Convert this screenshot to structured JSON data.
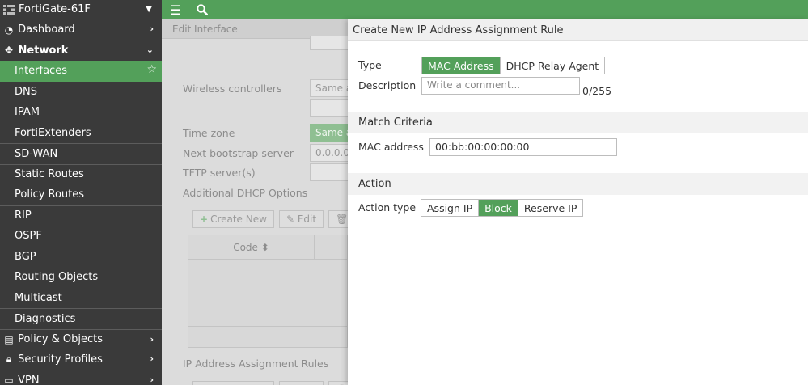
{
  "device": {
    "name": "FortiGate-61F"
  },
  "sidebar": {
    "top": [
      {
        "label": "Dashboard",
        "icon": "dashboard-icon"
      },
      {
        "label": "Network",
        "icon": "network-icon"
      }
    ],
    "network_items": [
      "Interfaces",
      "DNS",
      "IPAM",
      "FortiExtenders",
      "SD-WAN",
      "Static Routes",
      "Policy Routes",
      "RIP",
      "OSPF",
      "BGP",
      "Routing Objects",
      "Multicast",
      "Diagnostics"
    ],
    "bottom": [
      {
        "label": "Policy & Objects",
        "icon": "policy-objects-icon"
      },
      {
        "label": "Security Profiles",
        "icon": "lock-icon"
      },
      {
        "label": "VPN",
        "icon": "vpn-icon"
      }
    ]
  },
  "background": {
    "title": "Edit Interface",
    "wireless_controllers": "Wireless controllers",
    "same_as_1": "Same a",
    "time_zone": "Time zone",
    "same_as_2": "Same a",
    "next_bootstrap": "Next bootstrap server",
    "bootstrap_value": "0.0.0.0",
    "tftp": "TFTP server(s)",
    "additional_dhcp": "Additional DHCP Options",
    "create_new": "Create New",
    "edit": "Edit",
    "code_col": "Code",
    "ip_rules": "IP Address Assignment Rules"
  },
  "panel": {
    "title": "Create New IP Address Assignment Rule",
    "type_label": "Type",
    "type_options": [
      "MAC Address",
      "DHCP Relay Agent"
    ],
    "type_selected": "MAC Address",
    "description_label": "Description",
    "description_placeholder": "Write a comment...",
    "description_counter": "0/255",
    "match_criteria": "Match Criteria",
    "mac_label": "MAC address",
    "mac_value": "00:bb:00:00:00:00",
    "action_section": "Action",
    "action_type_label": "Action type",
    "action_options": [
      "Assign IP",
      "Block",
      "Reserve IP"
    ],
    "action_selected": "Block"
  },
  "colors": {
    "accent": "#53a05a",
    "sidebar_bg": "#3a3a3a"
  }
}
